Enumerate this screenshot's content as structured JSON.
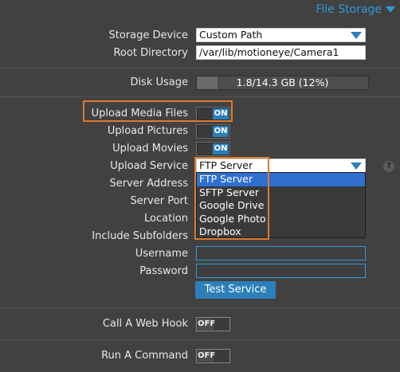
{
  "section": {
    "title": "File Storage"
  },
  "storage_device": {
    "label": "Storage Device",
    "value": "Custom Path"
  },
  "root_directory": {
    "label": "Root Directory",
    "value": "/var/lib/motioneye/Camera1"
  },
  "disk_usage": {
    "label": "Disk Usage",
    "text": "1.8/14.3 GB (12%)",
    "fraction": 0.12
  },
  "upload_media_files": {
    "label": "Upload Media Files",
    "state": "ON"
  },
  "upload_pictures": {
    "label": "Upload Pictures",
    "state": "ON"
  },
  "upload_movies": {
    "label": "Upload Movies",
    "state": "ON"
  },
  "upload_service": {
    "label": "Upload Service",
    "value": "FTP Server",
    "options": [
      "FTP Server",
      "SFTP Server",
      "Google Drive",
      "Google Photo",
      "Dropbox"
    ]
  },
  "server_address": {
    "label": "Server Address"
  },
  "server_port": {
    "label": "Server Port"
  },
  "location": {
    "label": "Location"
  },
  "include_subfolders": {
    "label": "Include Subfolders"
  },
  "username": {
    "label": "Username",
    "value": ""
  },
  "password": {
    "label": "Password",
    "value": ""
  },
  "test_service": {
    "label": "Test Service"
  },
  "call_web_hook": {
    "label": "Call A Web Hook",
    "state": "OFF"
  },
  "run_command": {
    "label": "Run A Command",
    "state": "OFF"
  },
  "help": {
    "glyph": "?"
  },
  "colors": {
    "accent": "#2e9bd8",
    "highlight": "#e07a2a",
    "background": "#414141"
  }
}
